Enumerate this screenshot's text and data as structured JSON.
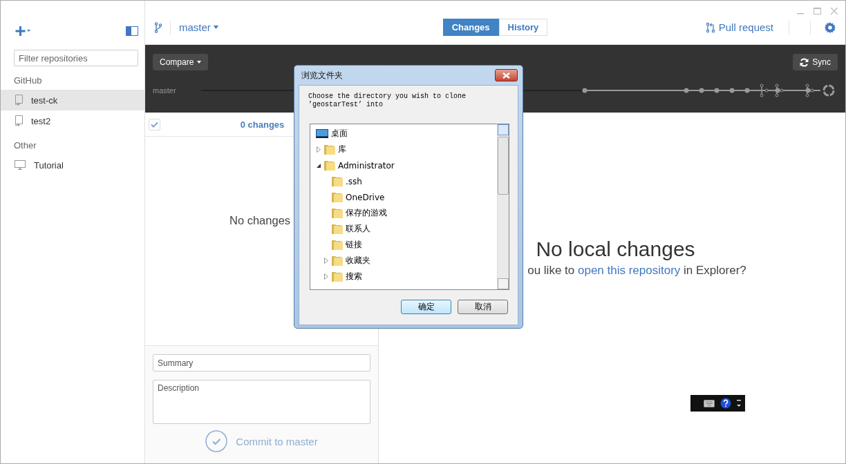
{
  "sidebar": {
    "filter": {
      "placeholder": "Filter repositories"
    },
    "groups": [
      {
        "title": "GitHub",
        "items": [
          {
            "name": "test-ck",
            "kind": "repo",
            "selected": true
          },
          {
            "name": "test2",
            "kind": "repo",
            "selected": false
          }
        ]
      },
      {
        "title": "Other",
        "items": [
          {
            "name": "Tutorial",
            "kind": "local",
            "selected": false
          }
        ]
      }
    ]
  },
  "toolbar": {
    "branch": "master",
    "tabs": [
      {
        "label": "Changes",
        "selected": true
      },
      {
        "label": "History",
        "selected": false
      }
    ],
    "pull_request": "Pull request"
  },
  "timeline": {
    "compare": "Compare",
    "sync": "Sync",
    "branch": "master"
  },
  "changes": {
    "checked": true,
    "count": "0 changes",
    "empty": "No changes"
  },
  "commit": {
    "summary_placeholder": "Summary",
    "description_placeholder": "Description",
    "button": "Commit to master",
    "disabled": true
  },
  "details": {
    "title": "No local changes",
    "prompt_before": "ou like to ",
    "link": "open this repository",
    "prompt_after": " in Explorer?"
  },
  "dialog": {
    "title": "浏览文件夹",
    "message": "Choose the directory you wish to clone\n’geostarTest’ into",
    "tree": [
      {
        "label": "桌面",
        "children": [
          {
            "label": "库",
            "expanded": false
          },
          {
            "label": "Administrator",
            "expanded": true,
            "children": [
              {
                "label": ".ssh"
              },
              {
                "label": "OneDrive"
              },
              {
                "label": "保存的游戏"
              },
              {
                "label": "联系人"
              },
              {
                "label": "链接"
              },
              {
                "label": "收藏夹",
                "expanded": false
              },
              {
                "label": "搜索",
                "expanded": false
              }
            ]
          }
        ]
      }
    ],
    "buttons": [
      {
        "label": "确定",
        "default": true
      },
      {
        "label": "取消",
        "default": false
      }
    ]
  }
}
